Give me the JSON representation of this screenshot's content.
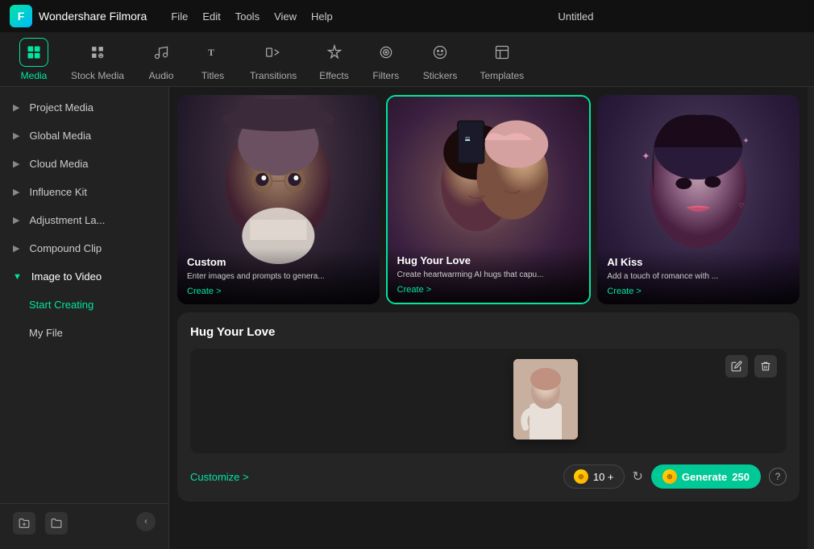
{
  "titlebar": {
    "logo_text": "F",
    "app_name": "Wondershare Filmora",
    "menu": [
      "File",
      "Edit",
      "Tools",
      "View",
      "Help"
    ],
    "project_name": "Untitled"
  },
  "tabs": [
    {
      "id": "media",
      "label": "Media",
      "icon": "⊡",
      "active": true
    },
    {
      "id": "stock-media",
      "label": "Stock Media",
      "icon": "🖼"
    },
    {
      "id": "audio",
      "label": "Audio",
      "icon": "♪"
    },
    {
      "id": "titles",
      "label": "Titles",
      "icon": "T"
    },
    {
      "id": "transitions",
      "label": "Transitions",
      "icon": "▷"
    },
    {
      "id": "effects",
      "label": "Effects",
      "icon": "✦"
    },
    {
      "id": "filters",
      "label": "Filters",
      "icon": "◎"
    },
    {
      "id": "stickers",
      "label": "Stickers",
      "icon": "☺"
    },
    {
      "id": "templates",
      "label": "Templates",
      "icon": "▦"
    }
  ],
  "sidebar": {
    "items": [
      {
        "id": "project-media",
        "label": "Project Media",
        "arrow": "▶",
        "active": false
      },
      {
        "id": "global-media",
        "label": "Global Media",
        "arrow": "▶",
        "active": false
      },
      {
        "id": "cloud-media",
        "label": "Cloud Media",
        "arrow": "▶",
        "active": false
      },
      {
        "id": "influence-kit",
        "label": "Influence Kit",
        "arrow": "▶",
        "active": false
      },
      {
        "id": "adjustment-layer",
        "label": "Adjustment La...",
        "arrow": "▶",
        "active": false
      },
      {
        "id": "compound-clip",
        "label": "Compound Clip",
        "arrow": "▶",
        "active": false
      },
      {
        "id": "image-to-video",
        "label": "Image to Video",
        "arrow": "▼",
        "active": true
      },
      {
        "id": "start-creating",
        "label": "Start Creating",
        "indent": true,
        "active": true
      },
      {
        "id": "my-file",
        "label": "My File",
        "indent": true,
        "active": false
      }
    ],
    "footer": {
      "add_folder": "+📁",
      "new_folder": "📁",
      "collapse": "‹"
    }
  },
  "cards": [
    {
      "id": "custom",
      "title": "Custom",
      "description": "Enter images and prompts to genera...",
      "create_label": "Create >"
    },
    {
      "id": "hug-your-love",
      "title": "Hug Your Love",
      "description": "Create heartwarming AI hugs that capu...",
      "create_label": "Create >",
      "selected": true
    },
    {
      "id": "ai-kiss",
      "title": "AI Kiss",
      "description": "Add a touch of romance with ...",
      "create_label": "Create >"
    }
  ],
  "ai_panel": {
    "title": "Hug Your Love",
    "customize_label": "Customize >",
    "coins_count": "10 +",
    "generate_label": "Generate",
    "generate_coins": "250",
    "help_icon": "?",
    "edit_icon": "✏",
    "delete_icon": "🗑"
  }
}
